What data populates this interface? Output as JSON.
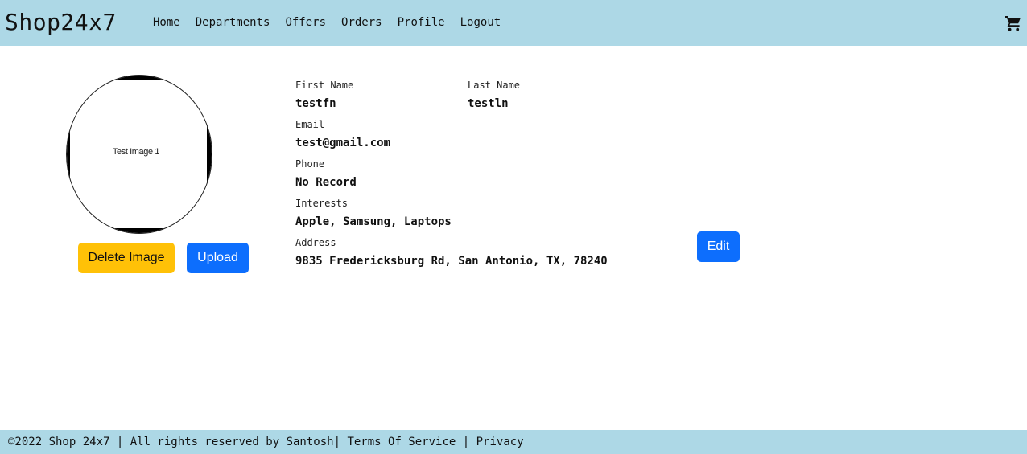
{
  "navbar": {
    "brand": "Shop24x7",
    "links": [
      "Home",
      "Departments",
      "Offers",
      "Orders",
      "Profile",
      "Logout"
    ],
    "cart_icon": "shopping-cart-icon"
  },
  "profile_image": {
    "alt_text": "Test Image 1"
  },
  "image_actions": {
    "delete_label": "Delete Image",
    "upload_label": "Upload"
  },
  "details": {
    "first_name": {
      "label": "First Name",
      "value": "testfn"
    },
    "last_name": {
      "label": "Last Name",
      "value": "testln"
    },
    "email": {
      "label": "Email",
      "value": "test@gmail.com"
    },
    "phone": {
      "label": "Phone",
      "value": "No Record"
    },
    "interests": {
      "label": "Interests",
      "value": "Apple, Samsung, Laptops"
    },
    "address": {
      "label": "Address",
      "value": "9835 Fredericksburg Rd, San Antonio, TX, 78240"
    },
    "edit_label": "Edit"
  },
  "footer": {
    "copyright": "©2022 Shop 24x7 | All rights reserved by Santosh",
    "separator_1": "|",
    "terms": "Terms Of Service",
    "separator_2": "|",
    "privacy": "Privacy"
  },
  "colors": {
    "navbar_bg": "#add8e6",
    "warning": "#ffc107",
    "primary": "#0d6efd"
  }
}
